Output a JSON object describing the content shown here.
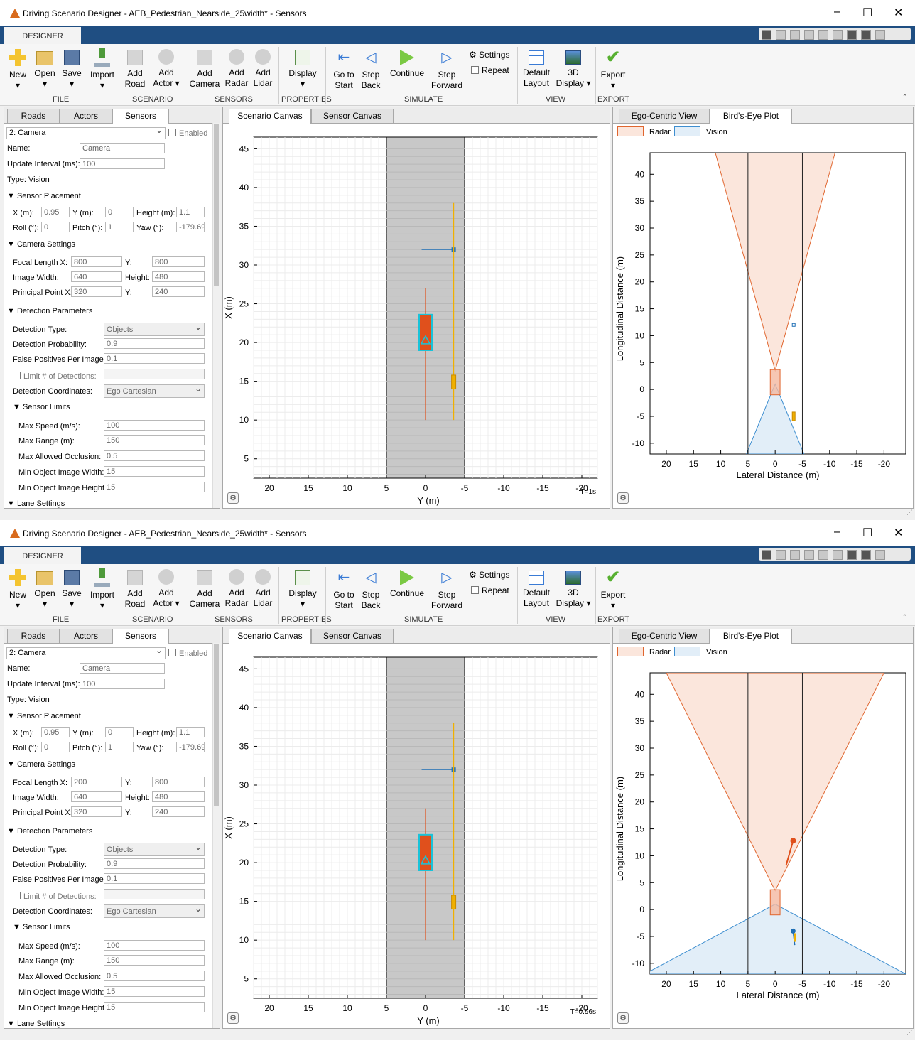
{
  "screens": [
    {
      "window_title": "Driving Scenario Designer - AEB_Pedestrian_Nearside_25width* - Sensors",
      "camera_settings_label": "Camera Settings",
      "focal_length_x": "800",
      "time_label": "T=1s",
      "vision_wide": false
    },
    {
      "window_title": "Driving Scenario Designer - AEB_Pedestrian_Nearside_25width* - Sensors",
      "camera_settings_label": "Camera Settings",
      "focal_length_x": "200",
      "time_label": "T=0.96s",
      "vision_wide": true
    }
  ],
  "window_controls": {
    "minimize": "–",
    "maximize": "☐",
    "close": "✕"
  },
  "ribbon": {
    "tab": "DESIGNER",
    "buttons": {
      "new": [
        "New",
        "▾"
      ],
      "open": [
        "Open",
        "▾"
      ],
      "save": [
        "Save",
        "▾"
      ],
      "import": [
        "Import",
        "▾"
      ],
      "add_road": [
        "Add",
        "Road"
      ],
      "add_actor": [
        "Add",
        "Actor ▾"
      ],
      "add_camera": [
        "Add",
        "Camera"
      ],
      "add_radar": [
        "Add",
        "Radar"
      ],
      "add_lidar": [
        "Add",
        "Lidar"
      ],
      "display": [
        "Display",
        "▾"
      ],
      "go_to_start": [
        "Go to",
        "Start"
      ],
      "step_back": [
        "Step",
        "Back"
      ],
      "continue": [
        "Continue",
        ""
      ],
      "step_forward": [
        "Step",
        "Forward"
      ],
      "settings": "Settings",
      "repeat": "Repeat",
      "default_layout": [
        "Default",
        "Layout"
      ],
      "3d_display": [
        "3D",
        "Display ▾"
      ],
      "export": [
        "Export",
        "▾"
      ]
    },
    "groups": {
      "file": "FILE",
      "scenario": "SCENARIO",
      "sensors": "SENSORS",
      "properties": "PROPERTIES",
      "simulate": "SIMULATE",
      "view": "VIEW",
      "export": "EXPORT"
    }
  },
  "left_tabs": [
    "Roads",
    "Actors",
    "Sensors"
  ],
  "sensor": {
    "selected": "2: Camera",
    "enabled_label": "Enabled",
    "name_label": "Name:",
    "name_value": "Camera",
    "update_interval_label": "Update Interval (ms):",
    "update_interval_value": "100",
    "type_label": "Type: Vision",
    "placement": {
      "header": "Sensor Placement",
      "x_label": "X (m):",
      "x_value": "0.95",
      "y_label": "Y (m):",
      "y_value": "0",
      "height_label": "Height (m):",
      "height_value": "1.1",
      "roll_label": "Roll (°):",
      "roll_value": "0",
      "pitch_label": "Pitch (°):",
      "pitch_value": "1",
      "yaw_label": "Yaw (°):",
      "yaw_value": "-179.69"
    },
    "camera": {
      "focal_x_label": "Focal Length X:",
      "focal_y_label": "Y:",
      "focal_y_value": "800",
      "image_width_label": "Image Width:",
      "image_width_value": "640",
      "height_label": "Height:",
      "height_value": "480",
      "principal_x_label": "Principal Point X:",
      "principal_x_value": "320",
      "principal_y_label": "Y:",
      "principal_y_value": "240"
    },
    "detection": {
      "header": "Detection Parameters",
      "type_label": "Detection Type:",
      "type_value": "Objects",
      "prob_label": "Detection Probability:",
      "prob_value": "0.9",
      "fp_label": "False Positives Per Image:",
      "fp_value": "0.1",
      "limit_label": "Limit # of Detections:",
      "coords_label": "Detection Coordinates:",
      "coords_value": "Ego Cartesian"
    },
    "limits": {
      "header": "Sensor Limits",
      "max_speed_label": "Max Speed (m/s):",
      "max_speed_value": "100",
      "max_range_label": "Max Range (m):",
      "max_range_value": "150",
      "max_occl_label": "Max Allowed Occlusion:",
      "max_occl_value": "0.5",
      "min_w_label": "Min Object Image Width:",
      "min_w_value": "15",
      "min_h_label": "Min Object Image Height:",
      "min_h_value": "15"
    },
    "lane_header": "Lane Settings"
  },
  "center_tabs": [
    "Scenario Canvas",
    "Sensor Canvas"
  ],
  "right_tabs": [
    "Ego-Centric View",
    "Bird's-Eye Plot"
  ],
  "scenario_axes": {
    "xlabel": "Y (m)",
    "ylabel": "X (m)",
    "yticks": [
      5,
      10,
      15,
      20,
      25,
      30,
      35,
      40,
      45
    ],
    "xticks": [
      20,
      15,
      10,
      5,
      0,
      -5,
      -10,
      -15,
      -20
    ]
  },
  "bev_axes": {
    "xlabel": "Lateral Distance (m)",
    "ylabel": "Longitudinal Distance (m)",
    "yticks": [
      -10,
      -5,
      0,
      5,
      10,
      15,
      20,
      25,
      30,
      35,
      40
    ],
    "xticks": [
      20,
      15,
      10,
      5,
      0,
      -5,
      -10,
      -15,
      -20
    ]
  },
  "legend": {
    "radar": "Radar",
    "vision": "Vision"
  },
  "colors": {
    "ribbon_bar": "#1f4e82",
    "road": "#c8c8c8",
    "ego": "#e0501c",
    "ego_outline": "#19c3d9",
    "target": "#1f6fb5",
    "pedestrian": "#f0b000",
    "radar_fill": "#fbe6dc",
    "radar_line": "#e0662f",
    "vision_fill": "#e2eef8",
    "vision_line": "#3d8ed0"
  }
}
